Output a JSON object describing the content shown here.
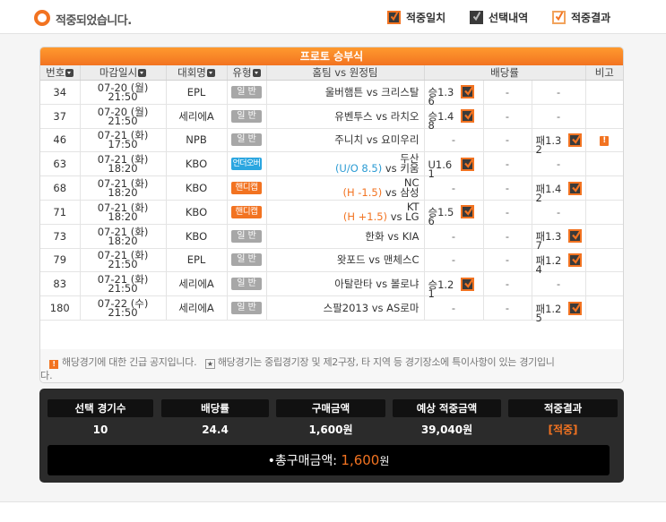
{
  "header": {
    "title": "적중되었습니다.",
    "legend": [
      {
        "label": "적중일치",
        "style": "orangeb",
        "checked": true
      },
      {
        "label": "선택내역",
        "style": "dark",
        "checked": true
      },
      {
        "label": "적중결과",
        "style": "light",
        "checked": true
      }
    ]
  },
  "panel": {
    "title": "프로토 승부식",
    "columns": {
      "num": "번호",
      "deadline": "마감일시",
      "league": "대회명",
      "type": "유형",
      "match": "홈팀 vs 원정팀",
      "odds": "배당률",
      "note": "비고"
    },
    "rows": [
      {
        "num": "34",
        "date": "07-20 (월)",
        "time": "21:50",
        "league": "EPL",
        "type": "일 반",
        "type_color": "gray",
        "home": "울버햄튼",
        "away": "크리스탈",
        "handicap": "",
        "win": "승1.36",
        "draw": "-",
        "lose": "-",
        "pick": "win",
        "note": ""
      },
      {
        "num": "37",
        "date": "07-20 (월)",
        "time": "21:50",
        "league": "세리에A",
        "type": "일 반",
        "type_color": "gray",
        "home": "유벤투스",
        "away": "라치오",
        "handicap": "",
        "win": "승1.48",
        "draw": "-",
        "lose": "-",
        "pick": "win",
        "note": ""
      },
      {
        "num": "46",
        "date": "07-21 (화)",
        "time": "17:50",
        "league": "NPB",
        "type": "일 반",
        "type_color": "gray",
        "home": "주니치",
        "away": "요미우리",
        "handicap": "",
        "win": "-",
        "draw": "-",
        "lose": "패1.32",
        "pick": "lose",
        "note": "!"
      },
      {
        "num": "63",
        "date": "07-21 (화)",
        "time": "18:20",
        "league": "KBO",
        "type": "언더오버",
        "type_color": "blue",
        "home": "두산",
        "away": "키움",
        "handicap": "(U/O 8.5)",
        "hc_style": "uo",
        "win": "U1.61",
        "draw": "-",
        "lose": "-",
        "pick": "win",
        "note": ""
      },
      {
        "num": "68",
        "date": "07-21 (화)",
        "time": "18:20",
        "league": "KBO",
        "type": "핸디캡",
        "type_color": "orange",
        "home": "NC",
        "away": "삼성",
        "handicap": "(H -1.5)",
        "hc_style": "hc",
        "win": "-",
        "draw": "-",
        "lose": "패1.42",
        "pick": "lose",
        "note": ""
      },
      {
        "num": "71",
        "date": "07-21 (화)",
        "time": "18:20",
        "league": "KBO",
        "type": "핸디캡",
        "type_color": "orange",
        "home": "KT",
        "away": "LG",
        "handicap": "(H +1.5)",
        "hc_style": "hc",
        "win": "승1.56",
        "draw": "-",
        "lose": "-",
        "pick": "win",
        "note": ""
      },
      {
        "num": "73",
        "date": "07-21 (화)",
        "time": "18:20",
        "league": "KBO",
        "type": "일 반",
        "type_color": "gray",
        "home": "한화",
        "away": "KIA",
        "handicap": "",
        "win": "-",
        "draw": "-",
        "lose": "패1.37",
        "pick": "lose",
        "note": ""
      },
      {
        "num": "79",
        "date": "07-21 (화)",
        "time": "21:50",
        "league": "EPL",
        "type": "일 반",
        "type_color": "gray",
        "home": "왓포드",
        "away": "맨체스C",
        "handicap": "",
        "win": "-",
        "draw": "-",
        "lose": "패1.24",
        "pick": "lose",
        "note": ""
      },
      {
        "num": "83",
        "date": "07-21 (화)",
        "time": "21:50",
        "league": "세리에A",
        "type": "일 반",
        "type_color": "gray",
        "home": "아탈란타",
        "away": "볼로냐",
        "handicap": "",
        "win": "승1.21",
        "draw": "-",
        "lose": "-",
        "pick": "win",
        "note": ""
      },
      {
        "num": "180",
        "date": "07-22 (수)",
        "time": "21:50",
        "league": "세리에A",
        "type": "일 반",
        "type_color": "gray",
        "home": "스팔2013",
        "away": "AS로마",
        "handicap": "",
        "win": "-",
        "draw": "-",
        "lose": "패1.25",
        "pick": "lose",
        "note": ""
      }
    ],
    "vs": "vs",
    "notice": {
      "icon1": "!",
      "text1": "해당경기에 대한 긴급 공지입니다.",
      "icon2": "★",
      "text2": "해당경기는 중립경기장 및 제2구장, 타 지역 등 경기장소에 특이사항이 있는 경기입니",
      "text3": "다."
    }
  },
  "summary": {
    "items": [
      {
        "label": "선택 경기수",
        "value": "10"
      },
      {
        "label": "배당률",
        "value": "24.4"
      },
      {
        "label": "구매금액",
        "value": "1,600원"
      },
      {
        "label": "예상 적중금액",
        "value": "39,040원"
      },
      {
        "label": "적중결과",
        "value": "[적중]"
      }
    ],
    "total_label": "•총구매금액:",
    "total_amount": "1,600",
    "total_unit": "원"
  },
  "colors": {
    "accent": "#f27321",
    "dark": "#2b2b2b",
    "blue": "#2ba6e0"
  }
}
